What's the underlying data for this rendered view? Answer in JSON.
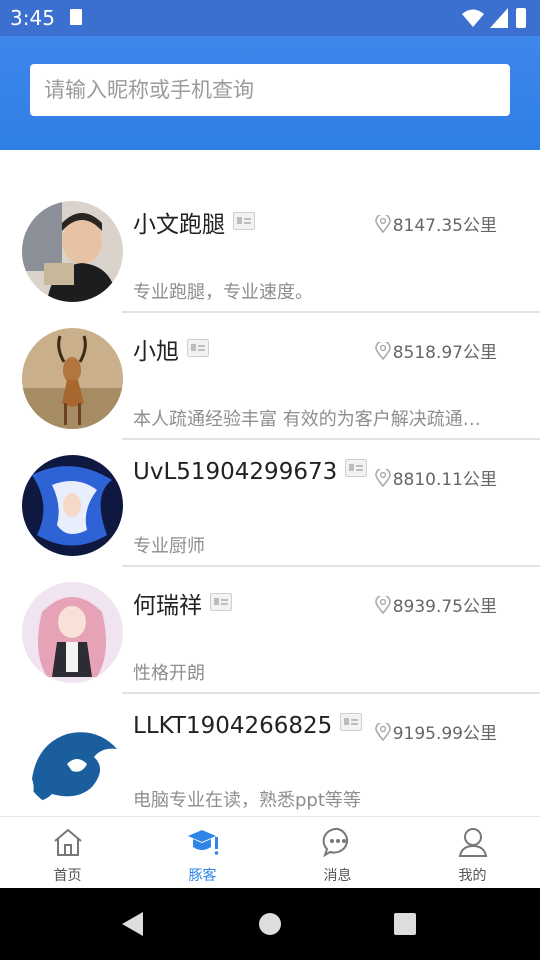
{
  "status_bar": {
    "time": "3:45"
  },
  "search": {
    "placeholder": "请输入昵称或手机查询",
    "value": ""
  },
  "users": [
    {
      "name": "小文跑腿",
      "distance": "8147.35公里",
      "desc": "专业跑腿，专业速度。"
    },
    {
      "name": "小旭",
      "distance": "8518.97公里",
      "desc": "本人疏通经验丰富 有效的为客户解决疏通…"
    },
    {
      "name": "UvL51904299673",
      "distance": "8810.11公里",
      "desc": "专业厨师"
    },
    {
      "name": "何瑞祥",
      "distance": "8939.75公里",
      "desc": "性格开朗"
    },
    {
      "name": "LLKT1904266825",
      "distance": "9195.99公里",
      "desc": "电脑专业在读，熟悉ppt等等"
    }
  ],
  "tabs": [
    {
      "label": "首页",
      "icon": "home-icon",
      "active": false
    },
    {
      "label": "豚客",
      "icon": "graduation-cap-icon",
      "active": true
    },
    {
      "label": "消息",
      "icon": "message-icon",
      "active": false
    },
    {
      "label": "我的",
      "icon": "profile-icon",
      "active": false
    }
  ],
  "colors": {
    "accent": "#2f86e8",
    "header": "#3f86ea",
    "status_bar": "#3b6fd0"
  }
}
